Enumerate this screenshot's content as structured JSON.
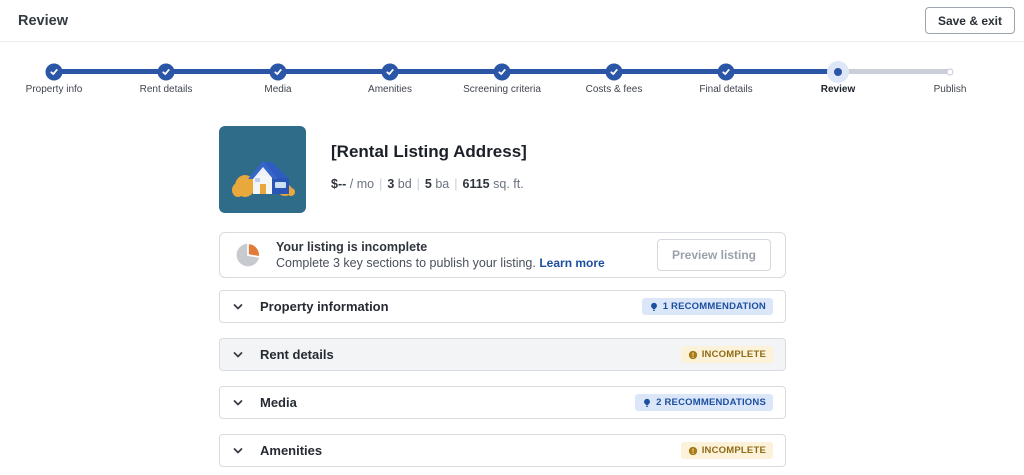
{
  "header": {
    "title": "Review",
    "save_exit_label": "Save & exit"
  },
  "stepper": {
    "steps": [
      {
        "label": "Property info",
        "state": "done"
      },
      {
        "label": "Rent details",
        "state": "done"
      },
      {
        "label": "Media",
        "state": "done"
      },
      {
        "label": "Amenities",
        "state": "done"
      },
      {
        "label": "Screening criteria",
        "state": "done"
      },
      {
        "label": "Costs & fees",
        "state": "done"
      },
      {
        "label": "Final details",
        "state": "done"
      },
      {
        "label": "Review",
        "state": "current"
      },
      {
        "label": "Publish",
        "state": "upcoming"
      }
    ]
  },
  "listing": {
    "title": "[Rental Listing Address]",
    "price_value": "$--",
    "price_unit": "/ mo",
    "beds_value": "3",
    "beds_unit": "bd",
    "baths_value": "5",
    "baths_unit": "ba",
    "sqft_value": "6115",
    "sqft_unit": "sq. ft.",
    "separator": "|"
  },
  "alert": {
    "title": "Your listing is incomplete",
    "message": "Complete 3 key sections to publish your listing.",
    "link_label": "Learn more",
    "preview_button_label": "Preview listing"
  },
  "sections": [
    {
      "title": "Property information",
      "badge": {
        "type": "recommendation",
        "label": "1 RECOMMENDATION"
      }
    },
    {
      "title": "Rent details",
      "badge": {
        "type": "incomplete",
        "label": "INCOMPLETE"
      }
    },
    {
      "title": "Media",
      "badge": {
        "type": "recommendation",
        "label": "2 RECOMMENDATIONS"
      }
    },
    {
      "title": "Amenities",
      "badge": {
        "type": "incomplete",
        "label": "INCOMPLETE"
      }
    }
  ],
  "colors": {
    "primary_blue": "#2b55a5",
    "track_gray": "#c9ced8",
    "recommendation_bg": "#dbe7f9",
    "recommendation_text": "#1d4fa1",
    "incomplete_bg": "#fcf2da",
    "incomplete_text": "#8f6b16",
    "incomplete_icon": "#a87a15",
    "pie_orange": "#e07b39",
    "pie_gray": "#c7cbd0",
    "thumbnail_bg": "#2e6c8a",
    "link_blue": "#1d4fa0"
  }
}
